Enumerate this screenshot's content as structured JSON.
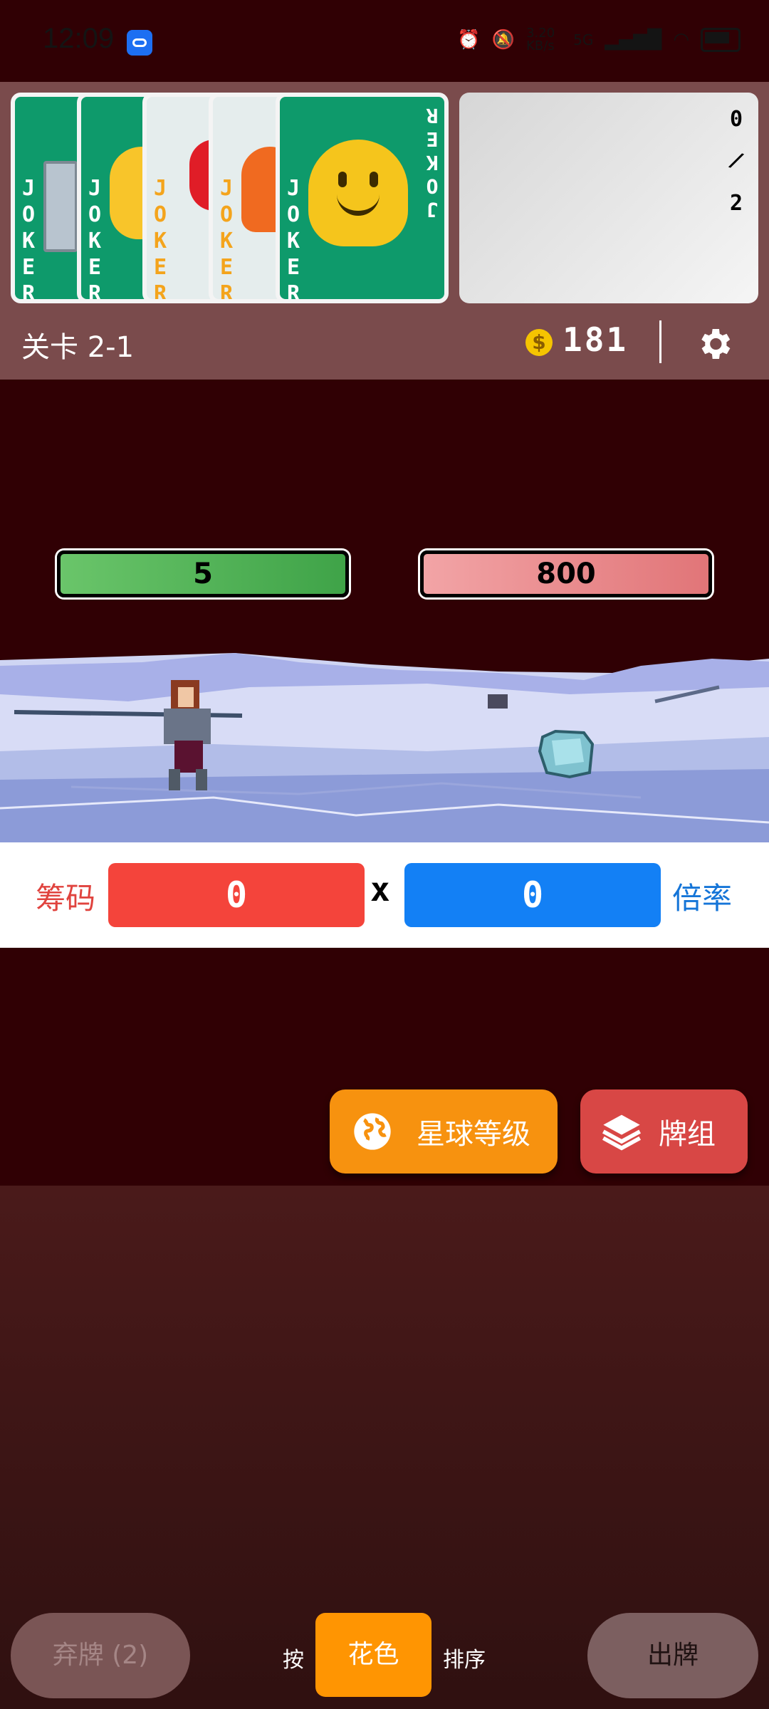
{
  "status_bar": {
    "time": "12:09",
    "net_speed": "3.20 KB/s",
    "signal": "5G"
  },
  "jokers": {
    "card_text": "JOKER",
    "cards": [
      {
        "art": "pillar-icon",
        "style": "green"
      },
      {
        "art": "cat-face-icon",
        "style": "green"
      },
      {
        "art": "boxing-glove-icon",
        "style": "white"
      },
      {
        "art": "fox-face-icon",
        "style": "white"
      },
      {
        "art": "melting-face-icon",
        "style": "green"
      }
    ]
  },
  "joker_slots": {
    "current": "0",
    "separator": "/",
    "max": "2"
  },
  "stage": {
    "label": "关卡 2-1"
  },
  "money": {
    "icon": "$",
    "value": "181"
  },
  "settings": {
    "icon": "gear-icon"
  },
  "battle": {
    "player_hp": "5",
    "enemy_hp": "800"
  },
  "score": {
    "chips_label": "筹码",
    "chips": "0",
    "times": "x",
    "mult": "0",
    "mult_label": "倍率"
  },
  "actions": {
    "planet_level": "星球等级",
    "deck": "牌组"
  },
  "bottom": {
    "discard": "弃牌 (2)",
    "sort_prefix": "按",
    "sort_suit": "花色",
    "sort_suffix": "排序",
    "play": "出牌"
  },
  "colors": {
    "chips": "#f4443b",
    "mult": "#1380f5",
    "planet_button": "#f7920f",
    "deck_button": "#d84745",
    "sort_active": "#ff9502"
  }
}
